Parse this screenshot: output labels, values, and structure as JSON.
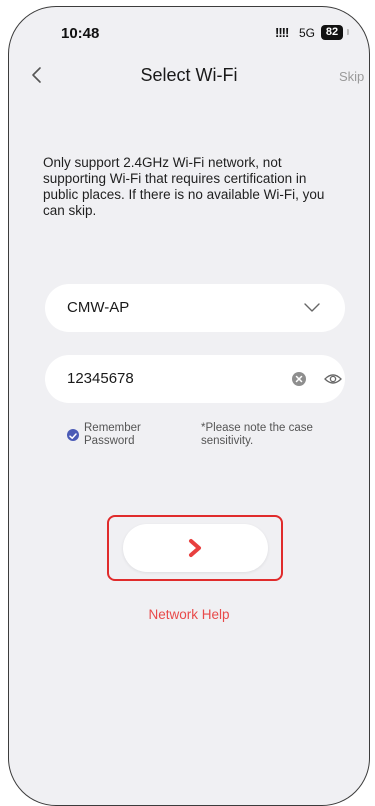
{
  "status_bar": {
    "time": "10:48",
    "signal": "!!!!",
    "network": "5G",
    "battery": "82"
  },
  "nav": {
    "title": "Select Wi-Fi",
    "skip_label": "Skip"
  },
  "info_text": "Only support 2.4GHz Wi-Fi network, not supporting Wi-Fi that requires certification in public places. If there is no available Wi-Fi, you can skip.",
  "form": {
    "ssid_value": "CMW-AP",
    "password_value": "12345678",
    "remember_label_line1": "Remember",
    "remember_label_line2": "Password",
    "remember_checked": true,
    "case_note_line1": "*Please note the case",
    "case_note_line2": "sensitivity."
  },
  "next_button": {
    "icon": "chevron-right-icon"
  },
  "network_help_label": "Network Help",
  "colors": {
    "accent": "#e84a4a",
    "highlight_border": "#e02b2b",
    "checkbox": "#4b5bb6",
    "background": "#f0f0f3"
  }
}
